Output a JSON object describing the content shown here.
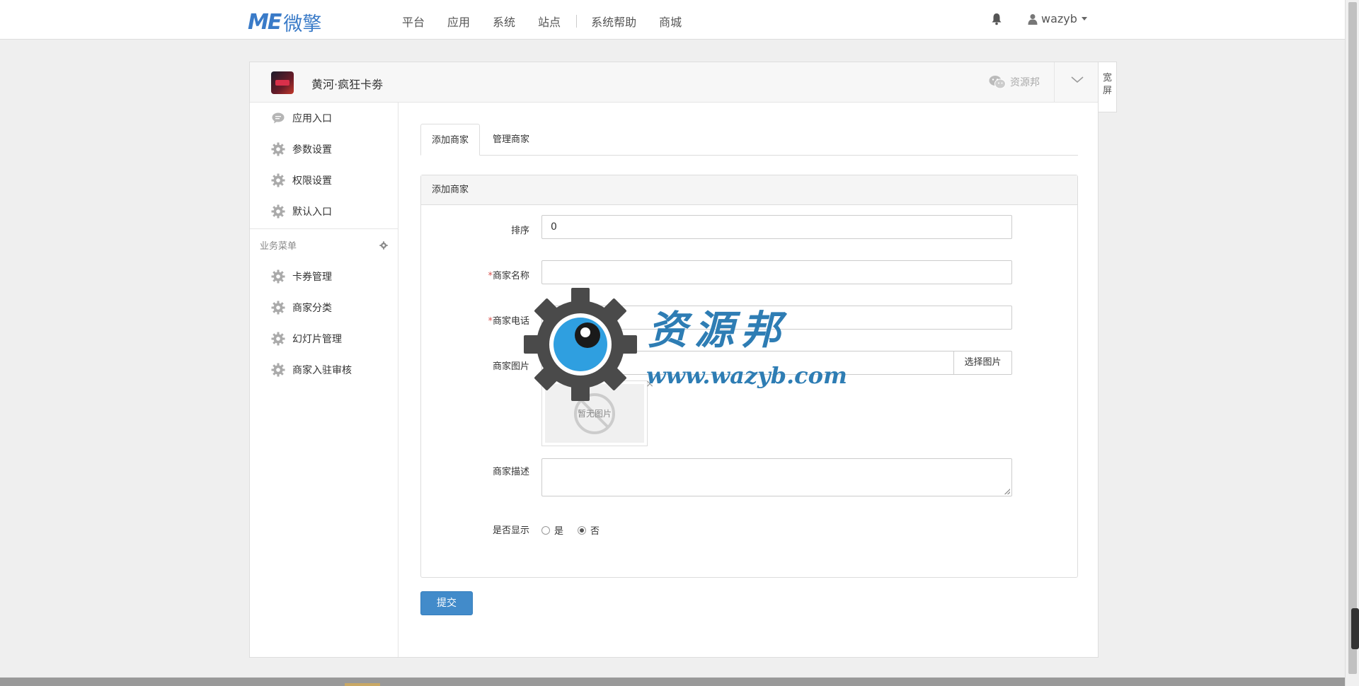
{
  "brand": {
    "mark": "ME",
    "name": "微擎"
  },
  "topnav": {
    "items": [
      "平台",
      "应用",
      "系统",
      "站点",
      "系统帮助",
      "商城"
    ],
    "user": "wazyb"
  },
  "app": {
    "title": "黄河·疯狂卡劵",
    "wechat_label": "资源邦",
    "wide_label": "宽屏"
  },
  "sidebar": {
    "items": [
      "应用入口",
      "参数设置",
      "权限设置",
      "默认入口"
    ],
    "group_title": "业务菜单",
    "group_items": [
      "卡券管理",
      "商家分类",
      "幻灯片管理",
      "商家入驻审核"
    ]
  },
  "tabs": [
    "添加商家",
    "管理商家"
  ],
  "form": {
    "panel_title": "添加商家",
    "sort_label": "排序",
    "sort_value": "0",
    "required_mark": "*",
    "name_label": "商家名称",
    "name_value": "",
    "phone_label": "商家电话",
    "phone_value": "",
    "image_label": "商家图片",
    "choose_image": "选择图片",
    "no_image": "暂无图片",
    "remove_mark": "×",
    "desc_label": "商家描述",
    "show_label": "是否显示",
    "yes": "是",
    "no": "否",
    "show_selected": "否",
    "submit": "提交"
  },
  "watermark": {
    "title": "资源邦",
    "url": "www.wazyb.com"
  },
  "colors": {
    "primary": "#428bca",
    "brand": "#3a7bc8",
    "watermark": "#2e7db4"
  }
}
